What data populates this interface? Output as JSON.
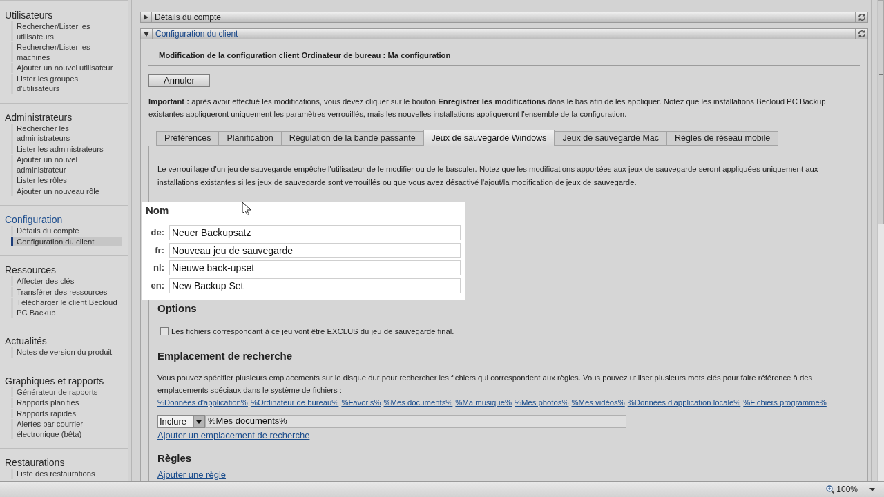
{
  "sidebar": {
    "sections": [
      {
        "title": "Utilisateurs",
        "selected": false,
        "items": [
          {
            "label": "Rechercher/Lister les utilisateurs",
            "selected": false
          },
          {
            "label": "Rechercher/Lister les machines",
            "selected": false
          },
          {
            "label": "Ajouter un nouvel utilisateur",
            "selected": false
          },
          {
            "label": "Lister les groupes d'utilisateurs",
            "selected": false
          }
        ]
      },
      {
        "title": "Administrateurs",
        "selected": false,
        "items": [
          {
            "label": "Rechercher les administrateurs",
            "selected": false
          },
          {
            "label": "Lister les administrateurs",
            "selected": false
          },
          {
            "label": "Ajouter un nouvel administrateur",
            "selected": false
          },
          {
            "label": "Lister les rôles",
            "selected": false
          },
          {
            "label": "Ajouter un nouveau rôle",
            "selected": false
          }
        ]
      },
      {
        "title": "Configuration",
        "selected": true,
        "items": [
          {
            "label": "Détails du compte",
            "selected": false
          },
          {
            "label": "Configuration du client",
            "selected": true
          }
        ]
      },
      {
        "title": "Ressources",
        "selected": false,
        "items": [
          {
            "label": "Affecter des clés",
            "selected": false
          },
          {
            "label": "Transférer des ressources",
            "selected": false
          },
          {
            "label": "Télécharger le client Becloud PC Backup",
            "selected": false
          }
        ]
      },
      {
        "title": "Actualités",
        "selected": false,
        "items": [
          {
            "label": "Notes de version du produit",
            "selected": false
          }
        ]
      },
      {
        "title": "Graphiques et rapports",
        "selected": false,
        "items": [
          {
            "label": "Générateur de rapports",
            "selected": false
          },
          {
            "label": "Rapports planifiés",
            "selected": false
          },
          {
            "label": "Rapports rapides",
            "selected": false
          },
          {
            "label": "Alertes par courrier électronique (bêta)",
            "selected": false
          }
        ]
      },
      {
        "title": "Restaurations",
        "selected": false,
        "items": [
          {
            "label": "Liste des restaurations",
            "selected": false
          }
        ]
      }
    ]
  },
  "accordion": [
    {
      "title": "Détails du compte",
      "expanded": false
    },
    {
      "title": "Configuration du client",
      "expanded": true
    }
  ],
  "client_config": {
    "title": "Modification de la configuration client Ordinateur de bureau : Ma configuration",
    "cancel_button": "Annuler",
    "notice": "**Important :** après avoir effectué les modifications, vous devez cliquer sur le bouton **Enregistrer les modifications** dans le bas afin de les appliquer. Notez que les installations Becloud PC Backup existantes appliqueront uniquement les paramètres verrouillés, mais les nouvelles installations appliqueront l'ensemble de la configuration.",
    "tabs": [
      {
        "label": "Préférences",
        "selected": false
      },
      {
        "label": "Planification",
        "selected": false
      },
      {
        "label": "Régulation de la bande passante",
        "selected": false
      },
      {
        "label": "Jeux de sauvegarde Windows",
        "selected": true
      },
      {
        "label": "Jeux de sauvegarde Mac",
        "selected": false
      },
      {
        "label": "Règles de réseau mobile",
        "selected": false
      }
    ],
    "tab_panel": {
      "description": "Le verrouillage d'un jeu de sauvegarde empêche l'utilisateur de le modifier ou de le basculer. Notez que les modifications apportées aux jeux de sauvegarde seront appliquées uniquement aux installations existantes si les jeux de sauvegarde sont verrouillés ou que vous avez désactivé l'ajout/la modification de jeux de sauvegarde.",
      "name_section": {
        "title": "Nom",
        "fields": [
          {
            "label": "de:",
            "value": "Neuer Backupsatz"
          },
          {
            "label": "fr:",
            "value": "Nouveau jeu de sauvegarde"
          },
          {
            "label": "nl:",
            "value": "Nieuwe back-upset"
          },
          {
            "label": "en:",
            "value": "New Backup Set"
          }
        ]
      },
      "options": {
        "title": "Options",
        "checkbox": {
          "label": "Les fichiers correspondant à ce jeu vont être EXCLUS du jeu de sauvegarde final.",
          "checked": false
        }
      },
      "search_location": {
        "title": "Emplacement de recherche",
        "description": "Vous pouvez spécifier plusieurs emplacements sur le disque dur pour rechercher les fichiers qui correspondent aux règles. Vous pouvez utiliser plusieurs mots clés pour faire référence à des emplacements spéciaux dans le système de fichiers :",
        "keywords": [
          "%Données d'application%",
          "%Ordinateur de bureau%",
          "%Favoris%",
          "%Mes documents%",
          "%Ma musique%",
          "%Mes photos%",
          "%Mes vidéos%",
          "%Données d'application locale%",
          "%Fichiers programme%"
        ],
        "rows": [
          {
            "mode": "Inclure",
            "path": "%Mes documents%"
          }
        ],
        "add_link": "Ajouter un emplacement de recherche"
      },
      "rules": {
        "title": "Règles",
        "add_link": "Ajouter une règle"
      }
    }
  },
  "status_bar": {
    "zoom": "100%"
  }
}
